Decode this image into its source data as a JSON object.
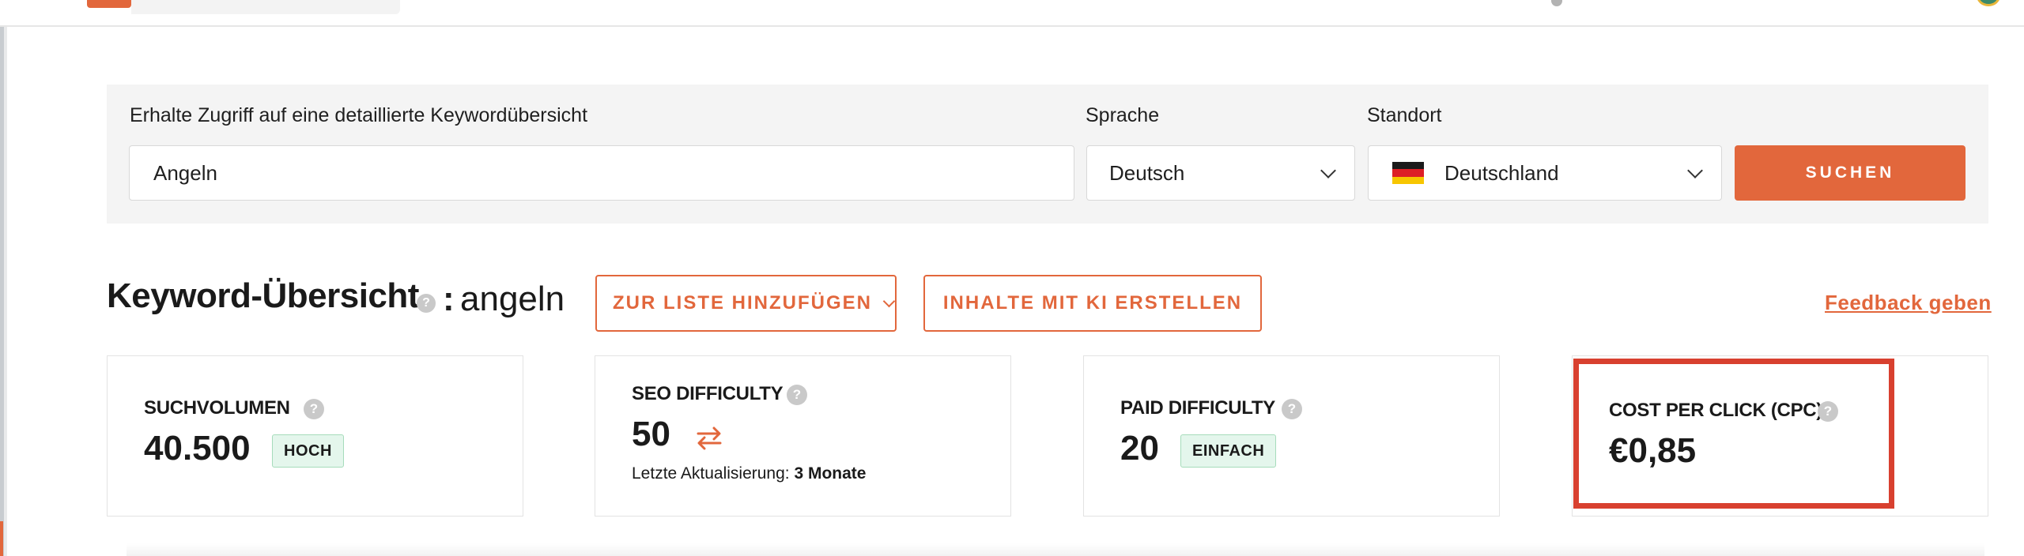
{
  "search_panel": {
    "keyword_label": "Erhalte Zugriff auf eine detaillierte Keywordübersicht",
    "keyword_value": "Angeln",
    "language_label": "Sprache",
    "language_value": "Deutsch",
    "location_label": "Standort",
    "location_value": "Deutschland",
    "search_button": "SUCHEN"
  },
  "overview": {
    "title": "Keyword-Übersicht",
    "separator": ":",
    "keyword": "angeln",
    "add_to_list_button": "ZUR LISTE HINZUFÜGEN",
    "ai_content_button": "INHALTE MIT KI ERSTELLEN",
    "feedback_link": "Feedback geben",
    "help_glyph": "?"
  },
  "cards": {
    "search_volume": {
      "label": "SUCHVOLUMEN",
      "value": "40.500",
      "badge": "HOCH"
    },
    "seo_difficulty": {
      "label": "SEO DIFFICULTY",
      "value": "50",
      "updated_prefix": "Letzte Aktualisierung:",
      "updated_value": "3 Monate"
    },
    "paid_difficulty": {
      "label": "PAID DIFFICULTY",
      "value": "20",
      "badge": "EINFACH"
    },
    "cpc": {
      "label": "COST PER CLICK (CPC)",
      "value": "€0,85"
    }
  },
  "colors": {
    "accent": "#e2673c",
    "highlight": "#d8402f",
    "badge_bg": "#e4f6ec",
    "panel_bg": "#f4f4f4"
  },
  "icons": [
    "help-icon",
    "chevron-down-icon",
    "germany-flag-icon",
    "refresh-icon"
  ]
}
